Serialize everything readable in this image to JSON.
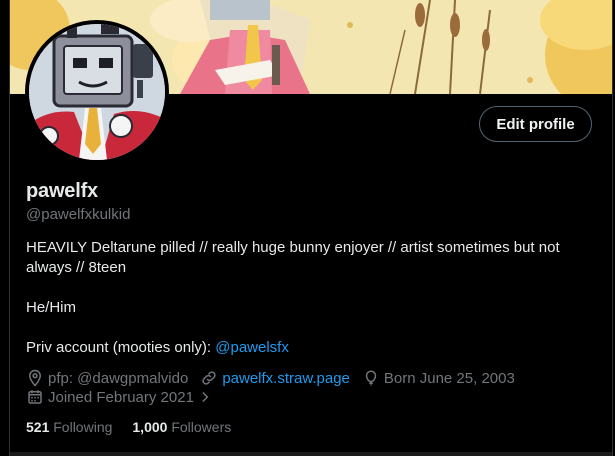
{
  "profile": {
    "display_name": "pawelfx",
    "handle": "@pawelfxkulkid",
    "edit_button": "Edit profile",
    "bio_line1": "HEAVILY Deltarune pilled // really huge bunny enjoyer // artist sometimes but not always // 8teen",
    "bio_line2": "He/Him",
    "bio_priv_prefix": "Priv account (mooties only): ",
    "bio_priv_link": "@pawelsfx",
    "location": "pfp: @dawgpmalvido",
    "website": "pawelfx.straw.page",
    "birthday": "Born June 25, 2003",
    "joined": "Joined February 2021",
    "following_count": "521",
    "following_label": "Following",
    "followers_count": "1,000",
    "followers_label": "Followers"
  },
  "icons": {
    "location": "location-pin-icon",
    "website": "link-icon",
    "birthday": "balloon-icon",
    "joined": "calendar-icon",
    "joined_more": "chevron-right-icon"
  },
  "colors": {
    "background": "#000000",
    "text": "#e7e9ea",
    "secondary": "#71767b",
    "link": "#1d9bf0",
    "border": "#536471"
  }
}
